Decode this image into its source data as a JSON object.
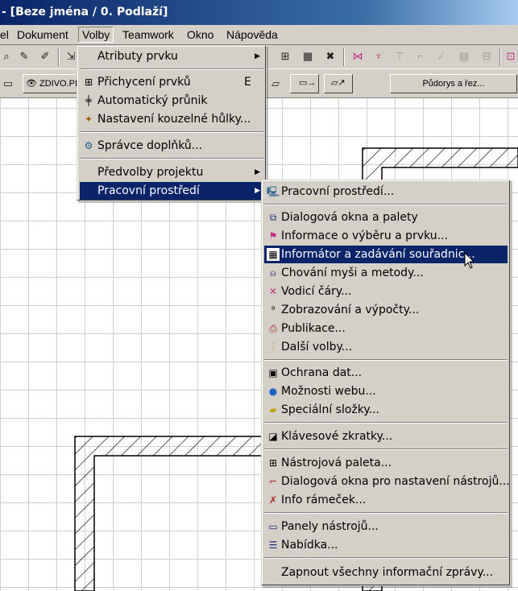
{
  "window": {
    "title": "- [Beze jména / 0. Podlaží]"
  },
  "menubar": {
    "items": [
      "el",
      "Dokument",
      "Volby",
      "Teamwork",
      "Okno",
      "Nápověda"
    ]
  },
  "toolbar": {
    "wall_label": "ZDIVO.PI",
    "view_button": "Půdorys a řez..."
  },
  "volby_menu": {
    "items": [
      {
        "label": "Atributy prvku",
        "submenu": true,
        "icon": "blank"
      },
      {
        "label": "Přichycení prvků",
        "shortcut": "E",
        "icon": "snap-icon"
      },
      {
        "label": "Automatický průnik",
        "icon": "intersect-icon"
      },
      {
        "label": "Nastavení kouzelné hůlky...",
        "icon": "magic-wand-icon"
      },
      {
        "label": "Správce doplňků...",
        "icon": "addon-manager-icon"
      },
      {
        "label": "Předvolby projektu",
        "submenu": true,
        "icon": "blank"
      },
      {
        "label": "Pracovní prostředí",
        "submenu": true,
        "icon": "blank",
        "highlighted": true
      }
    ]
  },
  "workspace_menu": {
    "items": [
      {
        "label": "Pracovní prostředí...",
        "icon": "workspace-icon"
      },
      {
        "label": "Dialogová okna a palety",
        "icon": "dialogs-icon"
      },
      {
        "label": "Informace o výběru a prvku...",
        "icon": "selection-info-icon"
      },
      {
        "label": "Informátor a zadávání souřadnic...",
        "icon": "coordinates-icon",
        "highlighted": true
      },
      {
        "label": "Chování myši a metody...",
        "icon": "mouse-icon"
      },
      {
        "label": "Vodicí čáry...",
        "icon": "guide-lines-icon"
      },
      {
        "label": "Zobrazování a výpočty...",
        "icon": "display-icon"
      },
      {
        "label": "Publikace...",
        "icon": "publish-icon"
      },
      {
        "label": "Další volby...",
        "icon": "more-options-icon"
      },
      {
        "label": "Ochrana dat...",
        "icon": "data-safety-icon"
      },
      {
        "label": "Možnosti webu...",
        "icon": "globe-icon"
      },
      {
        "label": "Speciální složky...",
        "icon": "folder-icon"
      },
      {
        "label": "Klávesové zkratky...",
        "icon": "shortcuts-icon"
      },
      {
        "label": "Nástrojová paleta...",
        "icon": "toolbox-icon"
      },
      {
        "label": "Dialogová okna pro nastavení nástrojů...",
        "icon": "tool-settings-icon"
      },
      {
        "label": "Info rámeček...",
        "icon": "info-box-icon"
      },
      {
        "label": "Panely nástrojů...",
        "icon": "toolbars-icon"
      },
      {
        "label": "Nabídka...",
        "icon": "menu-icon"
      },
      {
        "label": "Zapnout všechny informační zprávy...",
        "icon": "blank"
      }
    ]
  }
}
